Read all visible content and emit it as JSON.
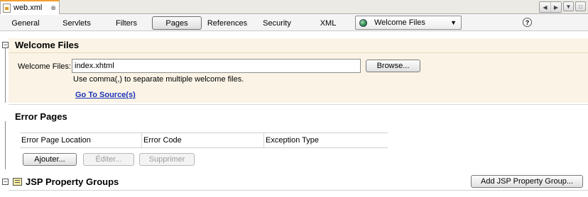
{
  "editor_tab": {
    "title": "web.xml",
    "close": "⊗"
  },
  "window_controls": {
    "left": "◀",
    "right": "▶",
    "down": "▼",
    "restore": "□"
  },
  "toolbar": {
    "tabs": [
      "General",
      "Servlets",
      "Filters",
      "Pages",
      "References",
      "Security",
      "XML"
    ],
    "active_tab": "Pages",
    "combo_value": "Welcome Files",
    "combo_arrow": "▼",
    "help": "?"
  },
  "welcome": {
    "title": "Welcome Files",
    "field_label": "Welcome Files:",
    "field_value": "index.xhtml",
    "browse_label": "Browse...",
    "hint": "Use comma(,) to separate multiple welcome files.",
    "go_to_source": "Go To Source(s)"
  },
  "error_pages": {
    "title": "Error Pages",
    "columns": [
      "Error Page Location",
      "Error Code",
      "Exception Type"
    ],
    "add_label": "Ajouter...",
    "edit_label": "Éditer...",
    "delete_label": "Supprimer"
  },
  "jsp": {
    "title": "JSP Property Groups",
    "add_label": "Add JSP Property Group..."
  },
  "collapse_symbol": "−",
  "colors": {
    "panel_bg": "#fbf4e6",
    "link": "#1c32b8",
    "tab_accent": "#f0a030"
  }
}
